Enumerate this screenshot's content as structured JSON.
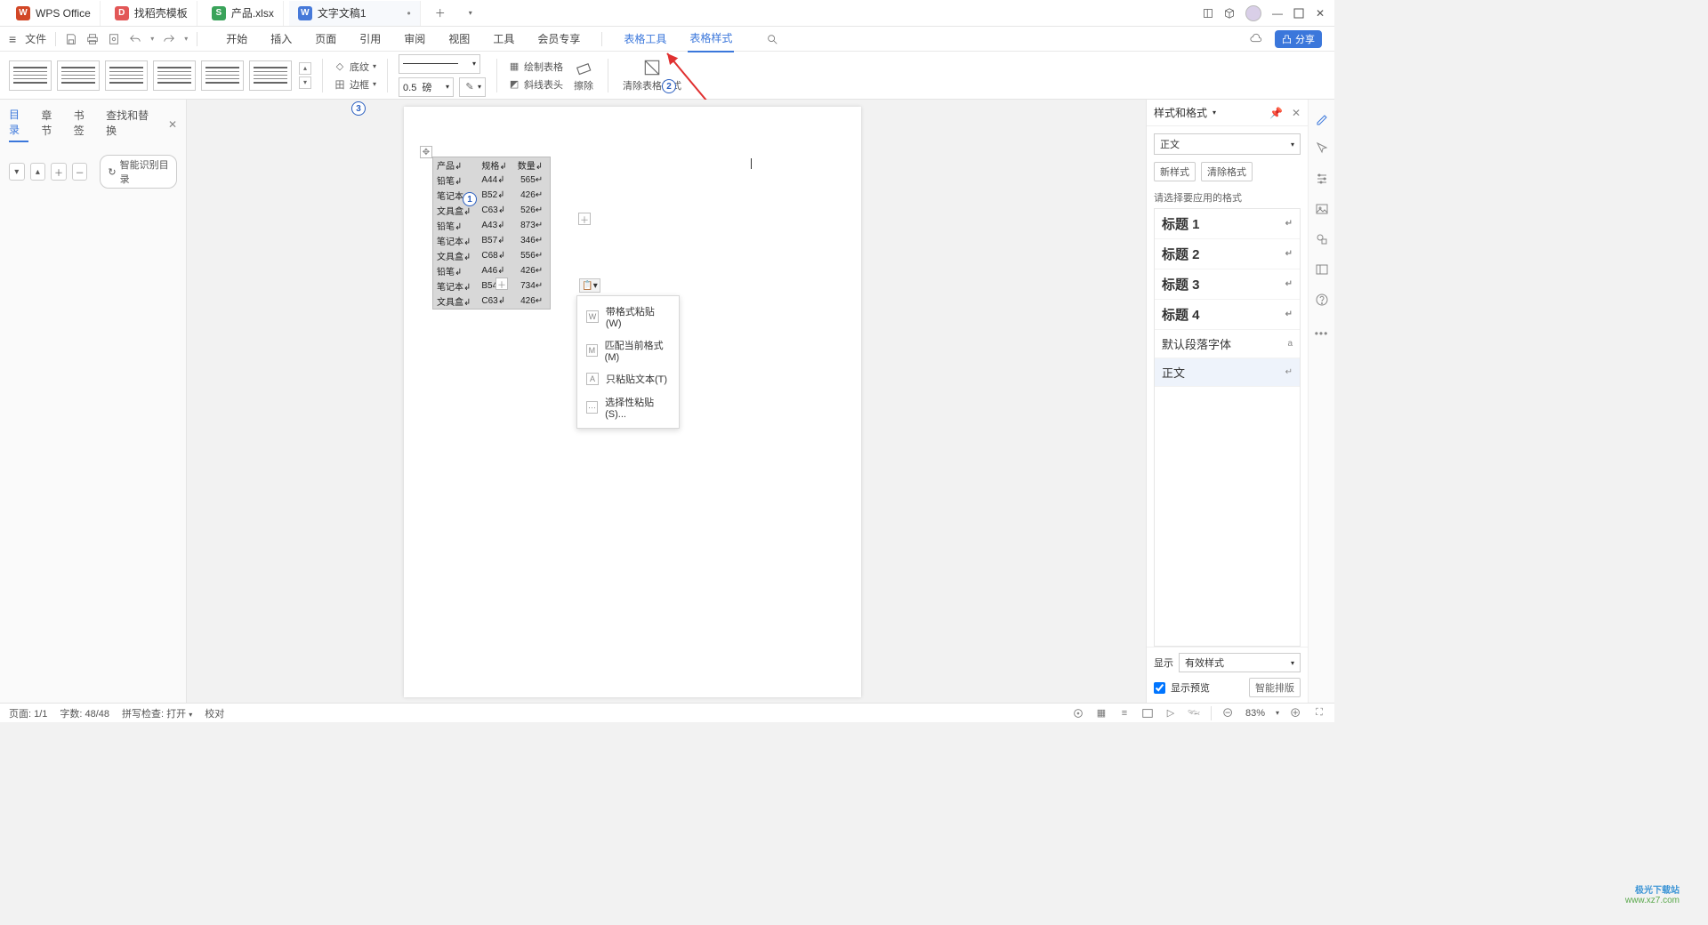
{
  "titlebar": {
    "app": "WPS Office",
    "tabs": [
      {
        "icon": "D",
        "cls": "c-d",
        "label": "找稻壳模板"
      },
      {
        "icon": "S",
        "cls": "c-s",
        "label": "产品.xlsx"
      },
      {
        "icon": "W",
        "cls": "c-wd",
        "label": "文字文稿1",
        "active": true,
        "dirty": "•"
      }
    ]
  },
  "qat": {
    "file": "文件"
  },
  "menu": {
    "items": [
      "开始",
      "插入",
      "页面",
      "引用",
      "审阅",
      "视图",
      "工具",
      "会员专享"
    ],
    "extra": [
      "表格工具",
      "表格样式"
    ],
    "active": "表格样式",
    "share": "分享"
  },
  "ribbon": {
    "shading": "底纹",
    "border": "边框",
    "weight_val": "0.5",
    "weight_unit": "磅",
    "draw_table": "绘制表格",
    "diag_head": "斜线表头",
    "erase": "擦除",
    "clear_style": "清除表格样式"
  },
  "nav": {
    "tabs": [
      "目录",
      "章节",
      "书签",
      "查找和替换"
    ],
    "active": "目录",
    "smart": "智能识别目录"
  },
  "table": {
    "headers": [
      "产品",
      "规格",
      "数量"
    ],
    "rows": [
      [
        "铅笔",
        "A44",
        "565"
      ],
      [
        "笔记本",
        "B52",
        "426"
      ],
      [
        "文具盒",
        "C63",
        "526"
      ],
      [
        "铅笔",
        "A43",
        "873"
      ],
      [
        "笔记本",
        "B57",
        "346"
      ],
      [
        "文具盒",
        "C68",
        "556"
      ],
      [
        "铅笔",
        "A46",
        "426"
      ],
      [
        "笔记本",
        "B54",
        "734"
      ],
      [
        "文具盒",
        "C63",
        "426"
      ]
    ]
  },
  "paste_menu": {
    "items": [
      "带格式粘贴(W)",
      "匹配当前格式(M)",
      "只粘贴文本(T)",
      "选择性粘贴(S)..."
    ]
  },
  "styles": {
    "title": "样式和格式",
    "current": "正文",
    "btn_new": "新样式",
    "btn_clear": "清除格式",
    "prompt": "请选择要应用的格式",
    "list": [
      {
        "name": "标题 1",
        "h": true
      },
      {
        "name": "标题 2",
        "h": true
      },
      {
        "name": "标题 3",
        "h": true
      },
      {
        "name": "标题 4",
        "h": true
      },
      {
        "name": "默认段落字体",
        "h": false
      },
      {
        "name": "正文",
        "h": false,
        "sel": true
      }
    ],
    "show_label": "显示",
    "show_val": "有效样式",
    "preview": "显示预览",
    "smart_layout": "智能排版"
  },
  "status": {
    "page": "页面: 1/1",
    "words": "字数: 48/48",
    "spell": "拼写检查: 打开",
    "proof": "校对",
    "zoom": "83%"
  },
  "badges": {
    "b1": "1",
    "b2": "2",
    "b3": "3"
  },
  "watermark": {
    "l1": "极光下载站",
    "l2": "www.xz7.com"
  }
}
